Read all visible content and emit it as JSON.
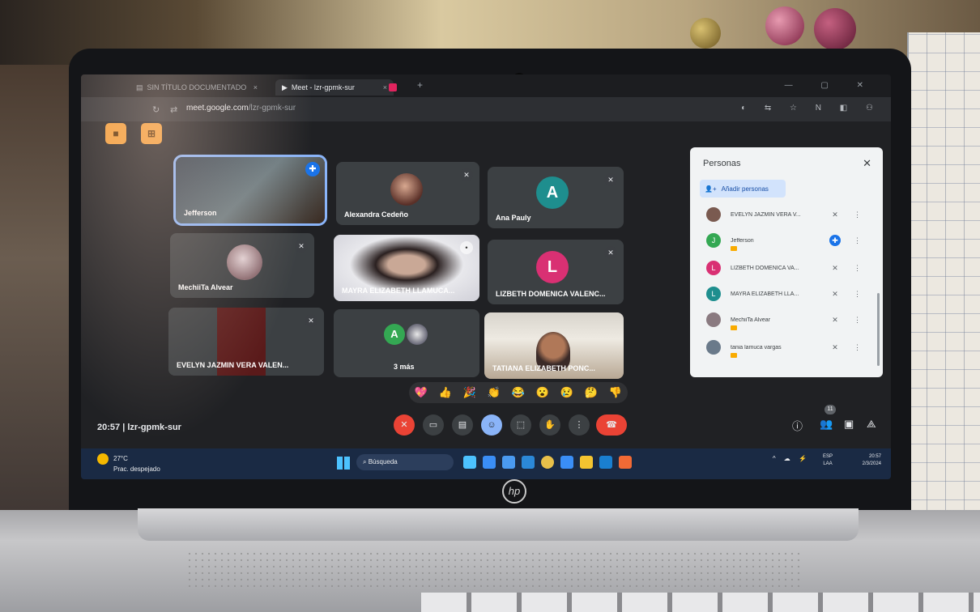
{
  "browser": {
    "tabs": [
      {
        "label": "SIN TÍTULO DOCUMENTADO"
      },
      {
        "label": "Meet - lzr-gpmk-sur"
      }
    ],
    "url": {
      "host": "meet.google.com",
      "path": "/lzr-gpmk-sur"
    }
  },
  "meet": {
    "meeting_code": "20:57 | lzr-gpmk-sur",
    "tiles": [
      {
        "name": "Jefferson"
      },
      {
        "name": "Alexandra Cedeño"
      },
      {
        "name": "Ana Pauly",
        "initial": "A",
        "color": "#1e8e8e"
      },
      {
        "name": "MechiiTa Alvear"
      },
      {
        "name": "MAYRA ELIZABETH LLAMUCA..."
      },
      {
        "name": "LIZBETH DOMENICA VALENC...",
        "initial": "L",
        "color": "#d93073"
      },
      {
        "name": "EVELYN JAZMIN VERA VALEN..."
      },
      {
        "name": "3 más",
        "initial": "A",
        "color": "#34a853"
      },
      {
        "name": "TATIANA ELIZABETH PONC..."
      }
    ],
    "reactions": [
      "💖",
      "👍",
      "🎉",
      "👏",
      "😂",
      "😮",
      "😢",
      "🤔",
      "👎"
    ],
    "people_count": "11"
  },
  "panel": {
    "title": "Personas",
    "add_label": "Añadir personas",
    "participants": [
      {
        "name": "EVELYN JAZMIN VERA V...",
        "initial": "",
        "color": "#7a5a50"
      },
      {
        "name": "Jefferson",
        "initial": "J",
        "color": "#34a853"
      },
      {
        "name": "LIZBETH DOMENICA VA...",
        "initial": "L",
        "color": "#d93073"
      },
      {
        "name": "MAYRA ELIZABETH LLA...",
        "initial": "L",
        "color": "#1e8e8e"
      },
      {
        "name": "MechiiTa Alvear",
        "initial": "",
        "color": "#8a7a80"
      },
      {
        "name": "tania lamuca vargas",
        "initial": "",
        "color": "#6a7a8a"
      }
    ]
  },
  "taskbar": {
    "temp": "27°C",
    "weather": "Prac. despejado",
    "search": "Búsqueda",
    "lang1": "ESP",
    "lang2": "LAA",
    "time": "20:57",
    "date": "2/3/2024"
  },
  "brand": {
    "logo": "hp"
  }
}
